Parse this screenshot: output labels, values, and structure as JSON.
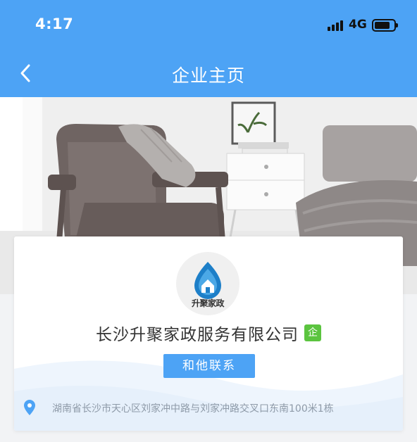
{
  "status_bar": {
    "time": "4:17",
    "network": "4G",
    "battery_level": 0.8
  },
  "nav": {
    "title": "企业主页"
  },
  "company": {
    "logo_text": "升聚家政",
    "name": "长沙升聚家政服务有限公司",
    "badge": "企",
    "contact_label": "和他联系",
    "address": "湖南省长沙市天心区刘家冲中路与刘家冲路交叉口东南100米1栋"
  },
  "colors": {
    "primary": "#4da3f5",
    "badge": "#5bc43f",
    "address_text": "#8e9aa8"
  },
  "icons": {
    "back": "chevron-left-icon",
    "location": "location-pin-icon"
  }
}
